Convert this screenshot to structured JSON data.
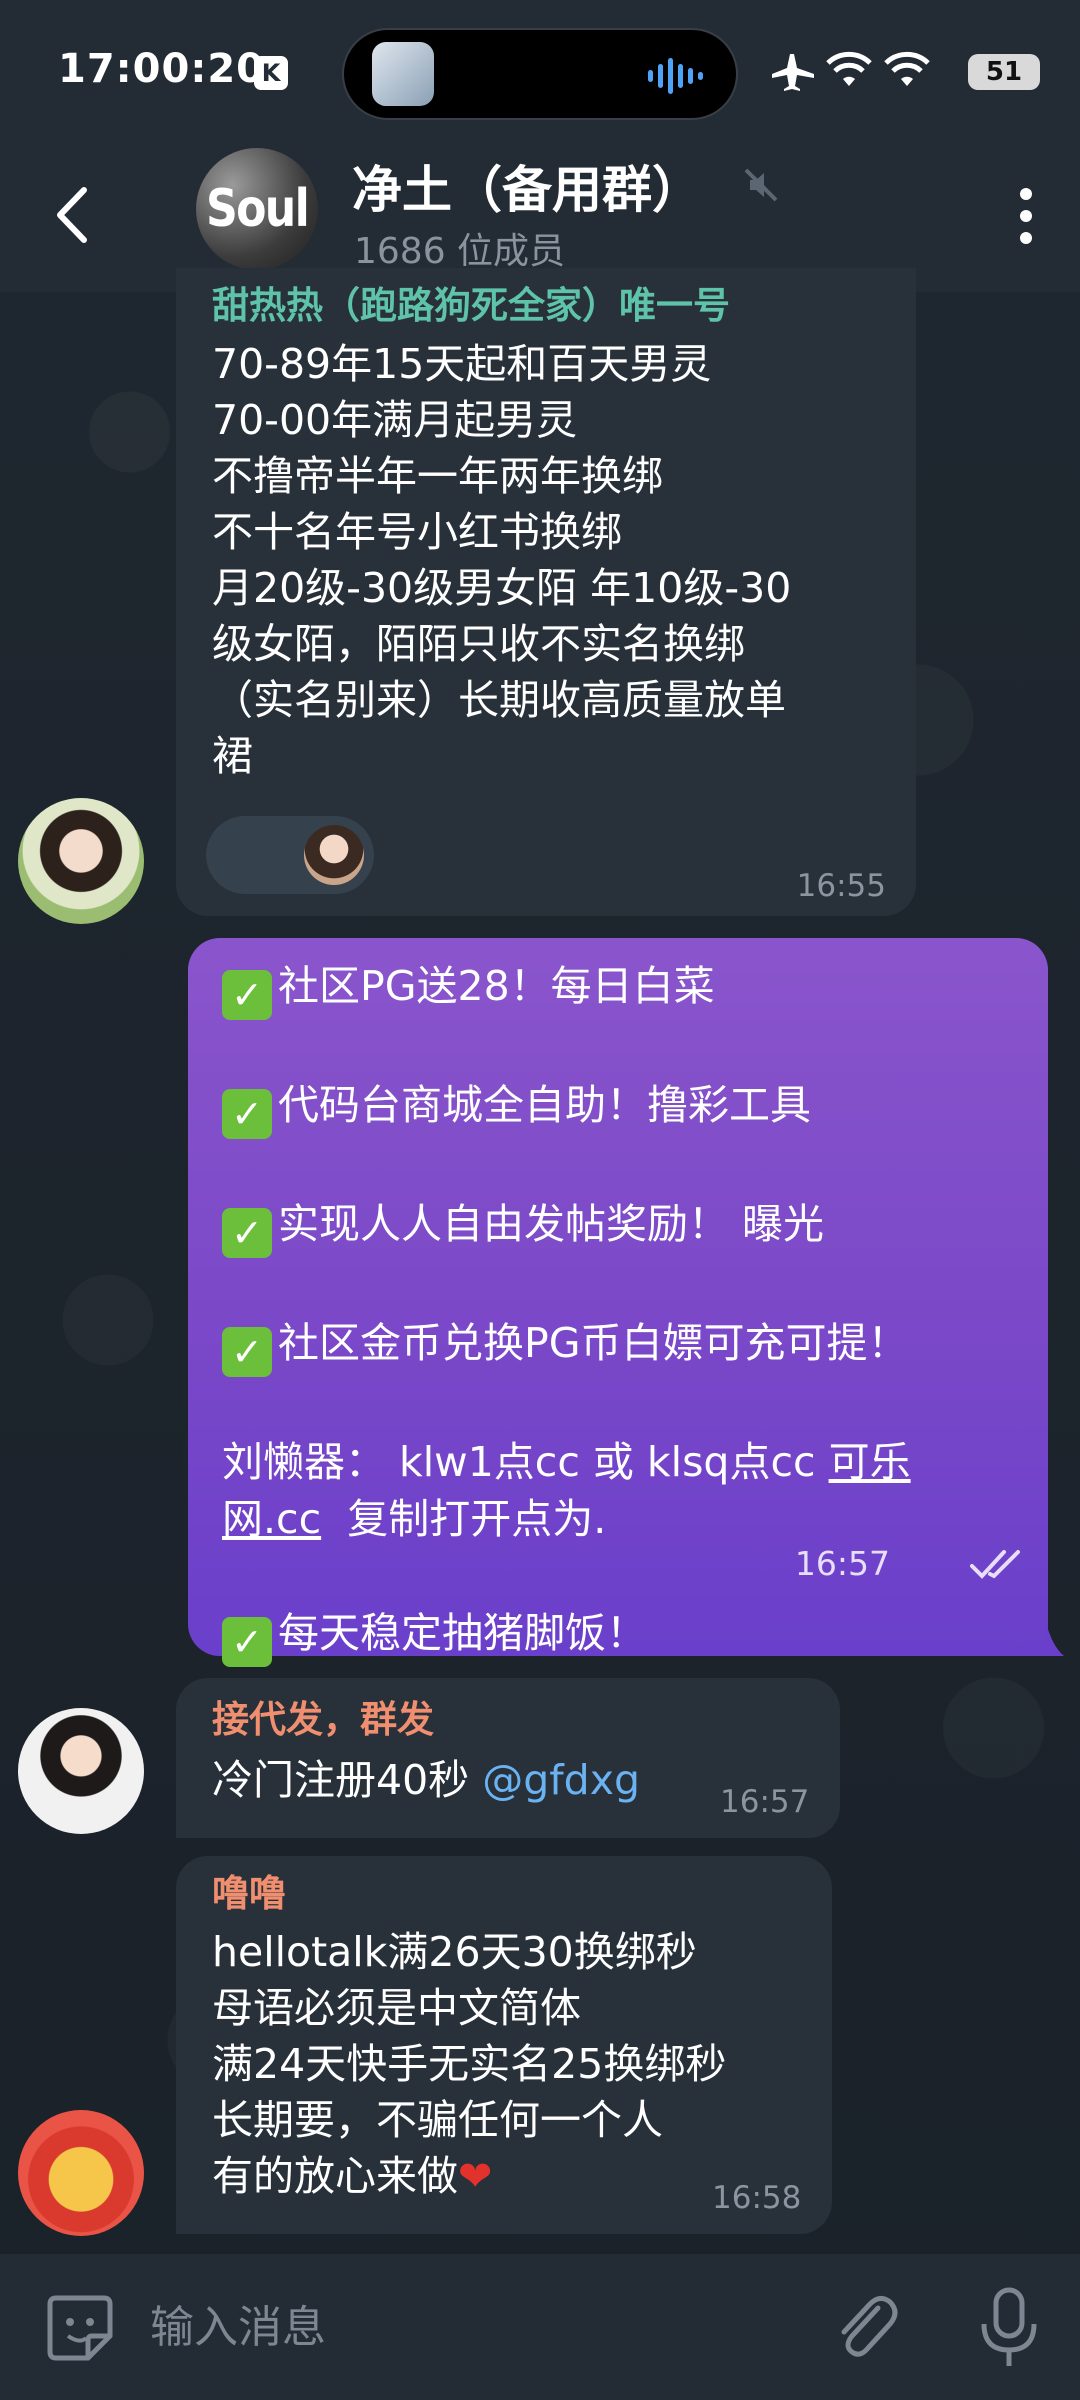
{
  "status_bar": {
    "time": "17:00:20",
    "k_badge": "K",
    "battery": "51"
  },
  "header": {
    "avatar_text": "Soul",
    "title": "净土（备用群）",
    "member_count": "1686 位成员"
  },
  "messages": [
    {
      "sender": "甜热热（跑路狗死全家）唯一号",
      "lines": [
        "70-89年15天起和百天男灵",
        "70-00年满月起男灵",
        "不撸帝半年一年两年换绑",
        "不十名年号小红书换绑",
        "月20级-30级男女陌 年10级-30",
        "级女陌，陌陌只收不实名换绑",
        "（实名别来）长期收高质量放单",
        "裙"
      ],
      "time": "16:55"
    },
    {
      "outgoing": true,
      "lines": [
        "社区PG送28！每日白菜",
        "代码台商城全自助！撸彩工具",
        "实现人人自由发帖奖励！ 曝光",
        "社区金币兑换PG币白嫖可充可提！",
        "刘懒器： klw1点cc 或 klsq点cc",
        "可乐",
        "网.cc",
        "复制打开点为.",
        "每天稳定抽猪脚饭！"
      ],
      "time": "16:57"
    },
    {
      "sender": "接代发，群发",
      "text": "冷门注册40秒",
      "mention": "@gfdxg",
      "time": "16:57"
    },
    {
      "sender": "噜噜",
      "lines": [
        "hellotalk满26天30换绑秒",
        "母语必须是中文简体",
        "满24天快手无实名25换绑秒",
        "长期要，不骗任何一个人",
        "有的放心来做"
      ],
      "heart": "❤",
      "time": "16:58"
    }
  ],
  "composer": {
    "placeholder": "输入消息"
  },
  "colors": {
    "header_bg": "#232b35",
    "bubble_in": "#283039",
    "bubble_out_top": "#8a55cc",
    "bubble_out_bottom": "#6a3fcb",
    "sender_green": "#5ec3a8",
    "sender_orange": "#ef8f6f",
    "mention_blue": "#6ab2f2"
  }
}
